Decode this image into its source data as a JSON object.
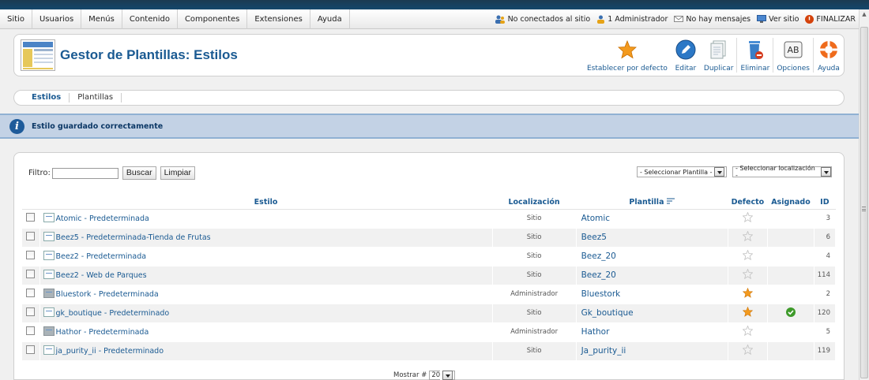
{
  "menu": {
    "items": [
      "Sitio",
      "Usuarios",
      "Menús",
      "Contenido",
      "Componentes",
      "Extensiones",
      "Ayuda"
    ],
    "status": {
      "visitors": "No conectados al sitio",
      "admins": "1 Administrador",
      "messages": "No hay mensajes",
      "view_site": "Ver sitio",
      "logout": "FINALIZAR"
    }
  },
  "header": {
    "title": "Gestor de Plantillas: Estilos"
  },
  "toolbar": {
    "default_label": "Establecer por defecto",
    "edit_label": "Editar",
    "duplicate_label": "Duplicar",
    "delete_label": "Eliminar",
    "options_label": "Opciones",
    "options_glyph": "AB",
    "help_label": "Ayuda"
  },
  "tabs": [
    {
      "label": "Estilos",
      "active": true
    },
    {
      "label": "Plantillas",
      "active": false
    }
  ],
  "message": "Estilo guardado correctamente",
  "filter": {
    "label": "Filtro:",
    "value": "",
    "search_button": "Buscar",
    "clear_button": "Limpiar",
    "template_select": "- Seleccionar Plantilla -",
    "location_select": "- Seleccionar localización -"
  },
  "table": {
    "headers": {
      "style": "Estilo",
      "location": "Localización",
      "template": "Plantilla",
      "default": "Defecto",
      "assigned": "Asignado",
      "id": "ID"
    },
    "rows": [
      {
        "style": "Atomic - Predeterminada",
        "location": "Sitio",
        "template": "Atomic",
        "default": false,
        "assigned": false,
        "id": "3",
        "admin": false
      },
      {
        "style": "Beez5 - Predeterminada-Tienda de Frutas",
        "location": "Sitio",
        "template": "Beez5",
        "default": false,
        "assigned": false,
        "id": "6",
        "admin": false
      },
      {
        "style": "Beez2 - Predeterminada",
        "location": "Sitio",
        "template": "Beez_20",
        "default": false,
        "assigned": false,
        "id": "4",
        "admin": false
      },
      {
        "style": "Beez2 - Web de Parques",
        "location": "Sitio",
        "template": "Beez_20",
        "default": false,
        "assigned": false,
        "id": "114",
        "admin": false
      },
      {
        "style": "Bluestork - Predeterminada",
        "location": "Administrador",
        "template": "Bluestork",
        "default": true,
        "assigned": false,
        "id": "2",
        "admin": true
      },
      {
        "style": "gk_boutique - Predeterminado",
        "location": "Sitio",
        "template": "Gk_boutique",
        "default": true,
        "assigned": true,
        "id": "120",
        "admin": false
      },
      {
        "style": "Hathor - Predeterminada",
        "location": "Administrador",
        "template": "Hathor",
        "default": false,
        "assigned": false,
        "id": "5",
        "admin": true
      },
      {
        "style": "ja_purity_ii - Predeterminado",
        "location": "Sitio",
        "template": "Ja_purity_ii",
        "default": false,
        "assigned": false,
        "id": "119",
        "admin": false
      }
    ]
  },
  "pagination": {
    "label": "Mostrar #",
    "value": "20"
  }
}
